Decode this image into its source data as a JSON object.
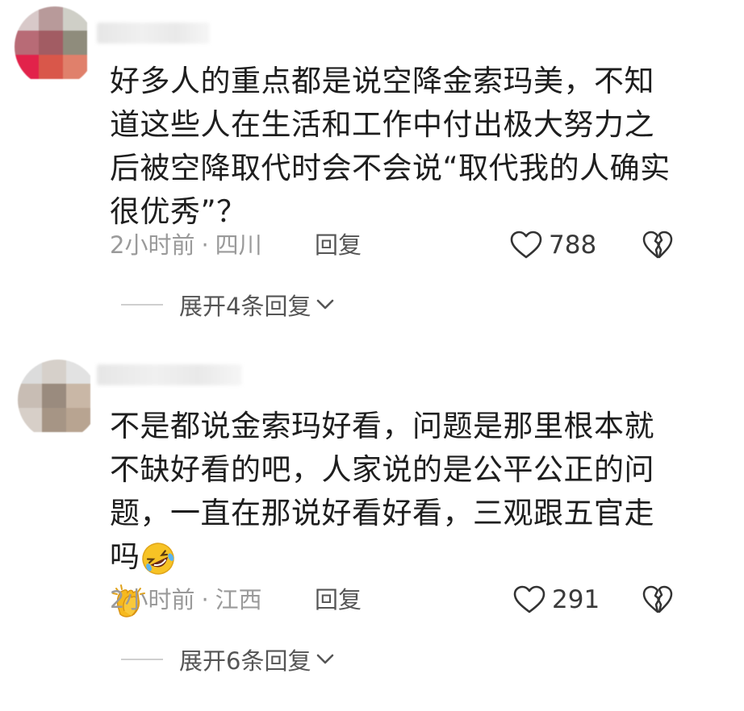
{
  "comments": [
    {
      "text": "好多人的重点都是说空降金索玛美，不知道这些人在生活和工作中付出极大努力之后被空降取代时会不会说“取代我的人确实很优秀”？",
      "time": "2小时前",
      "separator": "·",
      "location": "四川",
      "reply_label": "回复",
      "likes": "788",
      "expand_label": "展开4条回复"
    },
    {
      "text": "不是都说金索玛好看，问题是那里根本就不缺好看的吧，人家说的是公平公正的问题，一直在那说好看好看，三观跟五官走吗",
      "emojis": [
        "rolling-on-floor-laughing-emoji",
        "clapping-hands-emoji"
      ],
      "time": "2小时前",
      "separator": "·",
      "location": "江西",
      "reply_label": "回复",
      "likes": "291",
      "expand_label": "展开6条回复"
    }
  ],
  "icons": {
    "like": "heart-outline-icon",
    "dislike": "broken-heart-outline-icon",
    "expand": "chevron-down-icon"
  },
  "colors": {
    "text": "#1e1e1e",
    "meta": "#9a9a9a",
    "action": "#555555",
    "background": "#ffffff"
  }
}
